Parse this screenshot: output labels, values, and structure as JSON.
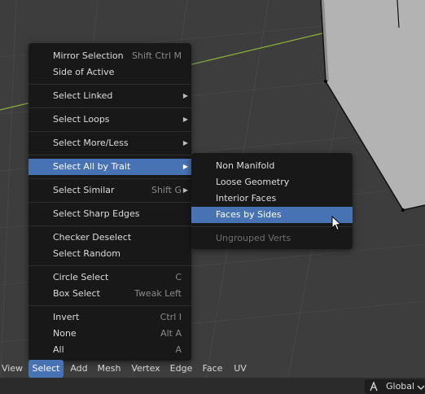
{
  "select_menu": {
    "items": [
      {
        "label": "Mirror Selection",
        "shortcut": "Shift Ctrl M"
      },
      {
        "label": "Side of Active",
        "shortcut": ""
      },
      {
        "label": "Select Linked",
        "shortcut": "",
        "submenu": true
      },
      {
        "label": "Select Loops",
        "shortcut": "",
        "submenu": true
      },
      {
        "label": "Select More/Less",
        "shortcut": "",
        "submenu": true
      },
      {
        "label": "Select All by Trait",
        "shortcut": "",
        "submenu": true,
        "active": true
      },
      {
        "label": "Select Similar",
        "shortcut": "Shift G",
        "submenu": true
      },
      {
        "label": "Select Sharp Edges",
        "shortcut": ""
      },
      {
        "label": "Checker Deselect",
        "shortcut": ""
      },
      {
        "label": "Select Random",
        "shortcut": ""
      },
      {
        "label": "Circle Select",
        "shortcut": "C"
      },
      {
        "label": "Box Select",
        "shortcut": "Tweak Left"
      },
      {
        "label": "Invert",
        "shortcut": "Ctrl I"
      },
      {
        "label": "None",
        "shortcut": "Alt A"
      },
      {
        "label": "All",
        "shortcut": "A"
      }
    ]
  },
  "submenu": {
    "items": [
      {
        "label": "Non Manifold"
      },
      {
        "label": "Loose Geometry"
      },
      {
        "label": "Interior Faces"
      },
      {
        "label": "Faces by Sides",
        "active": true
      },
      {
        "label": "Ungrouped Verts",
        "disabled": true
      }
    ]
  },
  "header": {
    "items": [
      "View",
      "Select",
      "Add",
      "Mesh",
      "Vertex",
      "Edge",
      "Face",
      "UV"
    ],
    "active": "Select"
  },
  "footer": {
    "orientation_label": "Global"
  },
  "icons": {
    "submenu_arrow": "triangle-right-icon",
    "cursor": "mouse-pointer-icon",
    "orientation": "transform-orientation-icon",
    "dropdown": "chevron-down-icon"
  },
  "colors": {
    "accent": "#4772b3",
    "menu_bg": "#181818",
    "viewport_bg": "#3d3d3d",
    "x_axis": "#8bb53a"
  }
}
